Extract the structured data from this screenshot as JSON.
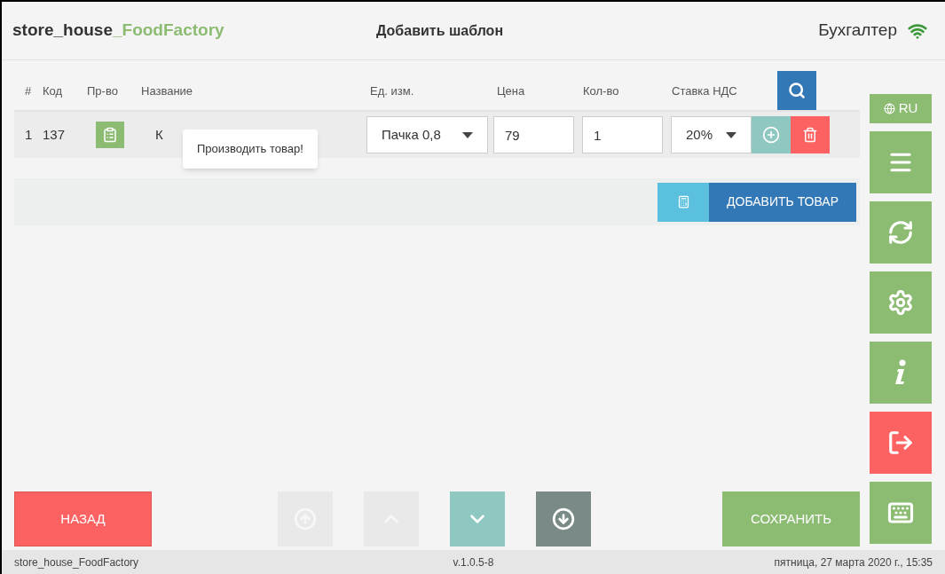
{
  "header": {
    "brand_prefix": "store_house",
    "brand_suffix": "_FoodFactory",
    "title": "Добавить шаблон",
    "user": "Бухгалтер"
  },
  "table": {
    "columns": [
      "#",
      "Код",
      "Пр-во",
      "Название",
      "Ед. изм.",
      "Цена",
      "Кол-во",
      "Ставка НДС"
    ],
    "rows": [
      {
        "index": "1",
        "code": "137",
        "name": "К",
        "unit": "Пачка 0,8",
        "price": "79",
        "quantity": "1",
        "vat": "20%"
      }
    ]
  },
  "tooltip": "Производить товар!",
  "add_product_button": "ДОБАВИТЬ ТОВАР",
  "sidebar": {
    "language": "RU",
    "items": [
      {
        "kind": "menu"
      },
      {
        "kind": "sync"
      },
      {
        "kind": "settings"
      },
      {
        "kind": "info"
      },
      {
        "kind": "exit"
      },
      {
        "kind": "keyboard"
      }
    ]
  },
  "footer": {
    "back": "НАЗАД",
    "save": "СОХРАНИТЬ",
    "nav": [
      {
        "kind": "first",
        "disabled": true
      },
      {
        "kind": "up",
        "disabled": true
      },
      {
        "kind": "down",
        "disabled": false
      },
      {
        "kind": "last",
        "disabled": false
      }
    ]
  },
  "status_bar": {
    "app": "store_house_FoodFactory",
    "version": "v.1.0.5-8",
    "datetime": "пятница, 27 марта 2020 г., 15:35"
  }
}
